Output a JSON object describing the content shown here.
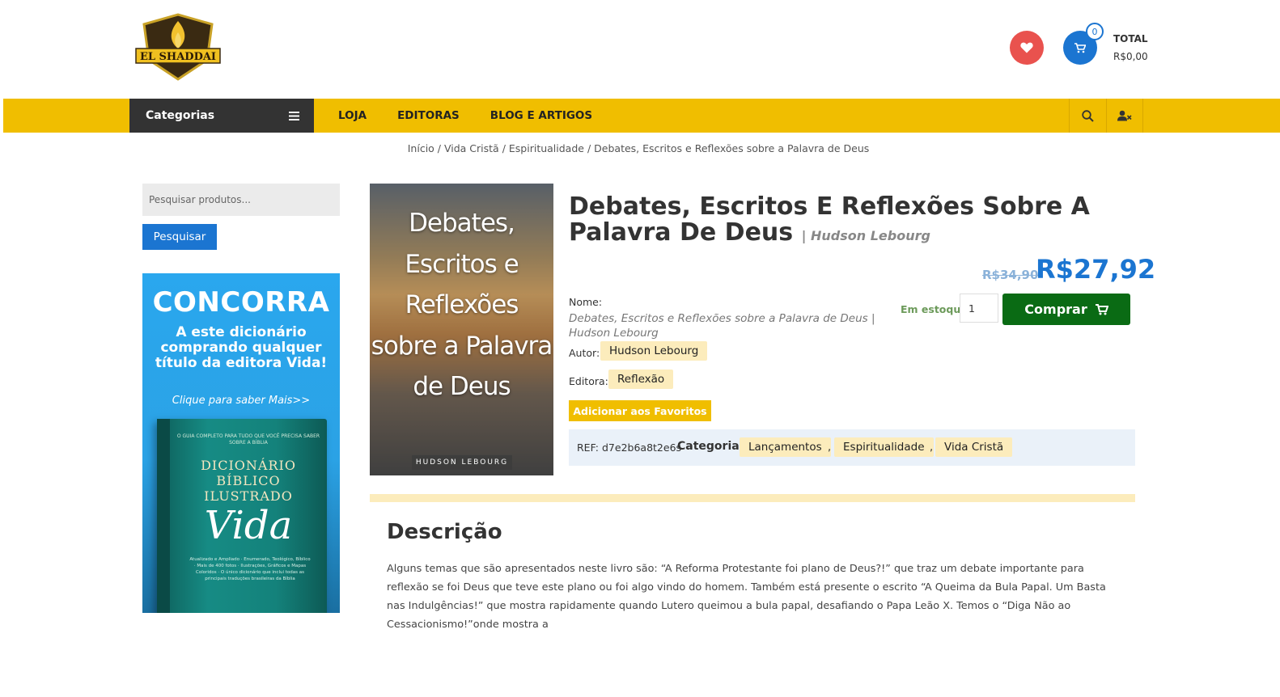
{
  "header": {
    "logo_text": "EL SHADDAI",
    "cart_count": "0",
    "total_label": "TOTAL",
    "total_value": "R$0,00"
  },
  "nav": {
    "categories_label": "Categorias",
    "items": [
      "LOJA",
      "EDITORAS",
      "BLOG E ARTIGOS"
    ]
  },
  "breadcrumb": {
    "items": [
      "Início",
      "Vida Cristã",
      "Espiritualidade"
    ],
    "current": "Debates, Escritos e Reflexões sobre a Palavra de Deus",
    "separator": " / "
  },
  "sidebar": {
    "search_placeholder": "Pesquisar produtos...",
    "search_button": "Pesquisar",
    "promo": {
      "title": "CONCORRA",
      "subtitle": "A este dicionário comprando qualquer título da editora Vida!",
      "link": "Clique para saber Mais>>",
      "book_top": "O GUIA COMPLETO PARA TUDO QUE VOCÊ PRECISA SABER SOBRE A BÍBLIA",
      "book_title": "DICIONÁRIO BÍBLICO ILUSTRADO",
      "book_vida": "Vida",
      "book_desc": "Atualizado e Ampliado · Enumerado, Teológico, Bíblico · Mais de 400 fotos · Ilustrações, Gráficos e Mapas Coloridos · O único dicionário que inclui todas as principais traduções brasileiras da Bíblia"
    }
  },
  "product": {
    "cover_title": "Debates, Escritos e Reflexões sobre a Palavra de Deus",
    "cover_author": "HUDSON LEBOURG",
    "title": "Debates, Escritos E Reflexões Sobre A Palavra De Deus",
    "author_suffix": "| Hudson Lebourg",
    "price_old": "R$34,90",
    "price_new": "R$27,92",
    "nome_label": "Nome:",
    "nome_value": "Debates, Escritos e Reflexões sobre a Palavra de Deus | Hudson Lebourg",
    "autor_label": "Autor:",
    "autor_value": "Hudson Lebourg",
    "editora_label": "Editora:",
    "editora_value": "Reflexão",
    "fav_button": "Adicionar aos Favoritos",
    "stock": "Em estoque",
    "qty": "1",
    "buy_button": "Comprar",
    "ref": "REF: d7e2b6a8t2e6s",
    "categories_label": "Categorias",
    "categories": [
      "Lançamentos",
      "Espiritualidade",
      "Vida Cristã"
    ],
    "comma": ","
  },
  "description": {
    "title": "Descrição",
    "text": "Alguns temas que são apresentados neste livro são: “A Reforma Protestante foi plano de Deus?!” que traz um debate importante para reflexão se foi Deus que teve este plano ou foi algo vindo do homem. Também está presente o escrito “A Queima da Bula Papal. Um Basta nas Indulgências!” que mostra rapidamente quando Lutero queimou a bula papal, desafiando o Papa Leão X. Temos o “Diga Não ao Cessacionismo!”onde mostra a"
  },
  "colors": {
    "brand_yellow": "#f0be00",
    "brand_blue": "#1b75d1",
    "buy_green": "#0a6b14",
    "fav_red": "#e9524e",
    "dark_nav": "#333333"
  },
  "icons": [
    "heart-icon",
    "cart-icon",
    "hamburger-menu-icon",
    "search-icon",
    "user-x-icon"
  ]
}
